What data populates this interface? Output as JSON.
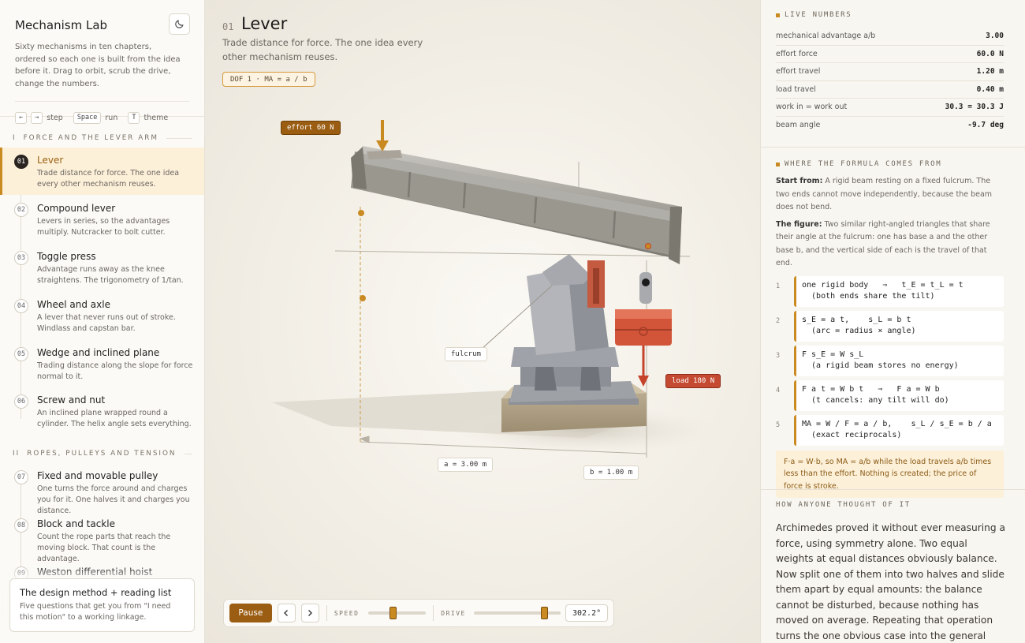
{
  "sidebar": {
    "title": "Mechanism Lab",
    "description": "Sixty mechanisms in ten chapters, ordered so each one is built from the idea before it. Drag to orbit, scrub the drive, change the numbers.",
    "keys": [
      {
        "key": "←",
        "key2": "→",
        "label": "step"
      },
      {
        "key": "Space",
        "label": "run"
      },
      {
        "key": "T",
        "label": "theme"
      }
    ],
    "chapters": [
      {
        "roman": "I",
        "title": "FORCE AND THE LEVER ARM"
      },
      {
        "roman": "II",
        "title": "ROPES, PULLEYS AND TENSION"
      }
    ],
    "items": [
      {
        "num": "01",
        "title": "Lever",
        "desc": "Trade distance for force. The one idea every other mechanism reuses."
      },
      {
        "num": "02",
        "title": "Compound lever",
        "desc": "Levers in series, so the advantages multiply. Nutcracker to bolt cutter."
      },
      {
        "num": "03",
        "title": "Toggle press",
        "desc": "Advantage runs away as the knee straightens. The trigonometry of 1/tan."
      },
      {
        "num": "04",
        "title": "Wheel and axle",
        "desc": "A lever that never runs out of stroke. Windlass and capstan bar."
      },
      {
        "num": "05",
        "title": "Wedge and inclined plane",
        "desc": "Trading distance along the slope for force normal to it."
      },
      {
        "num": "06",
        "title": "Screw and nut",
        "desc": "An inclined plane wrapped round a cylinder. The helix angle sets everything."
      },
      {
        "num": "07",
        "title": "Fixed and movable pulley",
        "desc": "One turns the force around and charges you for it. One halves it and charges you distance."
      },
      {
        "num": "08",
        "title": "Block and tackle",
        "desc": "Count the rope parts that reach the moving block. That count is the advantage."
      },
      {
        "num": "09",
        "title": "Weston differential hoist",
        "desc": ""
      }
    ],
    "design_card": {
      "title": "The design method + reading list",
      "desc": "Five questions that get you from \"I need this motion\" to a working linkage."
    }
  },
  "main": {
    "number": "01",
    "title": "Lever",
    "subtitle": "Trade distance for force. The one idea every other mechanism reuses.",
    "dof_pill": "DOF 1 · MA = a / b",
    "labels": {
      "effort": "effort 60 N",
      "load": "load 180 N",
      "fulcrum": "fulcrum",
      "a": "a = 3.00 m",
      "b": "b = 1.00 m"
    },
    "beam_angle_deg": -9.7,
    "controls": {
      "pause_label": "Pause",
      "speed_label": "SPEED",
      "speed_value": 0.42,
      "drive_label": "DRIVE",
      "drive_value": 0.84,
      "angle": "302.2°"
    }
  },
  "right": {
    "live": {
      "title": "LIVE NUMBERS",
      "rows": [
        {
          "label": "mechanical advantage a/b",
          "value": "3.00"
        },
        {
          "label": "effort force",
          "value": "60.0 N"
        },
        {
          "label": "effort travel",
          "value": "1.20 m"
        },
        {
          "label": "load travel",
          "value": "0.40 m"
        },
        {
          "label": "work in = work out",
          "value": "30.3 = 30.3 J"
        },
        {
          "label": "beam angle",
          "value": "-9.7 deg"
        }
      ]
    },
    "formula": {
      "title": "WHERE THE FORMULA COMES FROM",
      "start_label": "Start from:",
      "start_text": " A rigid beam resting on a fixed fulcrum. The two ends cannot move independently, because the beam does not bend.",
      "figure_label": "The figure:",
      "figure_text": " Two similar right-angled triangles that share their angle at the fulcrum: one has base a and the other base b, and the vertical side of each is the travel of that end.",
      "steps": [
        {
          "n": "1",
          "text": "one rigid body   ⇒   t_E = t_L = t\n  (both ends share the tilt)"
        },
        {
          "n": "2",
          "text": "s_E = a t,    s_L = b t\n  (arc = radius × angle)"
        },
        {
          "n": "3",
          "text": "F s_E = W s_L\n  (a rigid beam stores no energy)"
        },
        {
          "n": "4",
          "text": "F a t = W b t   ⇒   F a = W b\n  (t cancels: any tilt will do)"
        },
        {
          "n": "5",
          "text": "MA = W / F = a / b,    s_L / s_E = b / a\n  (exact reciprocals)"
        }
      ],
      "note": "F·a = W·b, so MA = a/b while the load travels a/b times less than the effort. Nothing is created; the price of force is stroke."
    },
    "how": {
      "title": "HOW ANYONE THOUGHT OF IT",
      "text": "Archimedes proved it without ever measuring a force, using symmetry alone. Two equal weights at equal distances obviously balance. Now split one of them into two halves and slide them apart by equal amounts: the balance cannot be disturbed, because nothing has moved on average. Repeating that operation turns the one obvious case into the general proportion. The leap is realising that a statement about forces can be established"
    }
  }
}
